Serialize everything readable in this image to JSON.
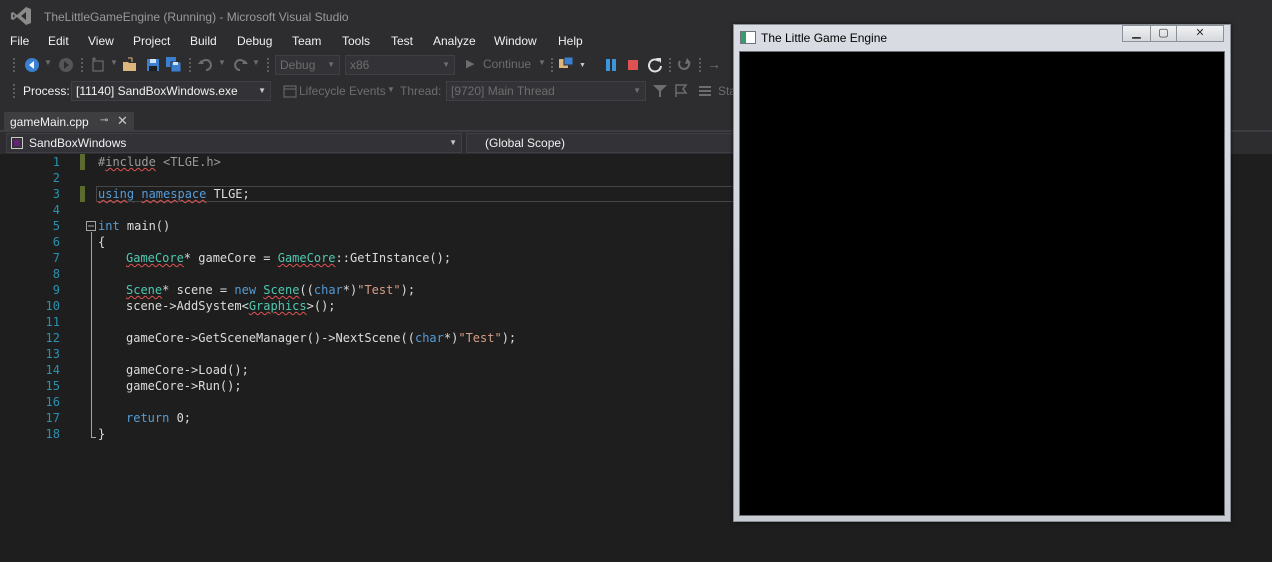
{
  "window": {
    "title": "TheLittleGameEngine (Running) - Microsoft Visual Studio"
  },
  "menu": [
    "File",
    "Edit",
    "View",
    "Project",
    "Build",
    "Debug",
    "Team",
    "Tools",
    "Test",
    "Analyze",
    "Window",
    "Help"
  ],
  "toolbar": {
    "configuration": "Debug",
    "platform": "x86",
    "continue_label": "Continue"
  },
  "debug_location": {
    "process_label": "Process:",
    "process_value": "[11140] SandBoxWindows.exe",
    "lifecycle_label": "Lifecycle Events",
    "thread_label": "Thread:",
    "thread_value": "[9720] Main Thread",
    "stackframe_label": "Sta"
  },
  "tab": {
    "filename": "gameMain.cpp"
  },
  "navbar": {
    "project": "SandBoxWindows",
    "scope": "(Global Scope)"
  },
  "editor": {
    "line_numbers": [
      "1",
      "2",
      "3",
      "4",
      "5",
      "6",
      "7",
      "8",
      "9",
      "10",
      "11",
      "12",
      "13",
      "14",
      "15",
      "16",
      "17",
      "18"
    ],
    "lines": [
      "#include <TLGE.h>",
      "",
      "using namespace TLGE;",
      "",
      "int main()",
      "{",
      "GameCore* gameCore = GameCore::GetInstance();",
      "",
      "Scene* scene = new Scene((char*)\"Test\");",
      "scene->AddSystem<Graphics>();",
      "",
      "gameCore->GetSceneManager()->NextScene((char*)\"Test\");",
      "",
      "gameCore->Load();",
      "gameCore->Run();",
      "",
      "return 0;",
      "}"
    ]
  },
  "game_window": {
    "title": "The Little Game Engine"
  },
  "colors": {
    "editor_bg": "#1e1e1e",
    "chrome_bg": "#2d2d30",
    "keyword": "#569cd6",
    "type": "#4ec9b0",
    "string": "#d69d85",
    "line_number": "#2b91af",
    "vs_purple": "#68217a"
  }
}
